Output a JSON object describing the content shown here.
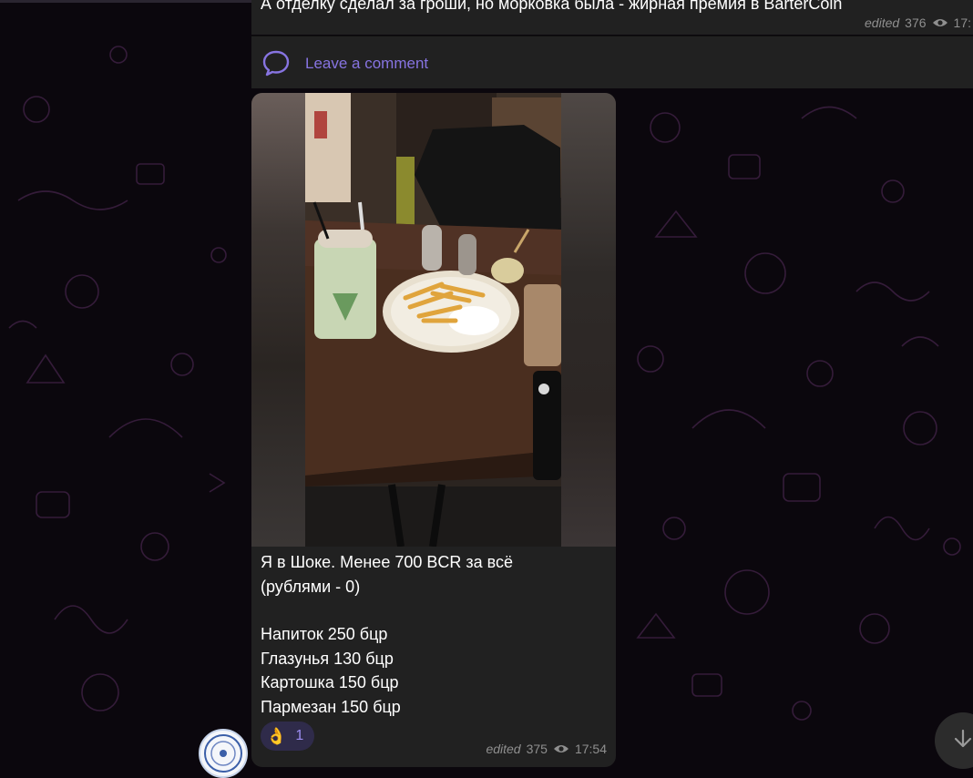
{
  "previous_message": {
    "text": "А отделку сделал за гроши, но морковка была - жирная премия в BarterCoin",
    "edited_label": "edited",
    "views": "376",
    "time": "17:"
  },
  "comments": {
    "label": "Leave a comment",
    "icon": "comment-bubble-icon"
  },
  "post": {
    "caption_lines": [
      "Я в Шоке. Менее 700 BCR за всё",
      "(рублями - 0)",
      "",
      "Напиток 250 бцр",
      "Глазунья 130 бцр",
      "Картошка 150 бцр",
      "Пармезан 150 бцр"
    ],
    "reaction": {
      "emoji": "👌",
      "count": "1"
    },
    "edited_label": "edited",
    "views": "375",
    "time": "17:54"
  },
  "colors": {
    "bubble": "#212121",
    "accent": "#8774e1",
    "background": "#0b070d",
    "meta": "#8f8f8f"
  },
  "icons": [
    "eye-icon",
    "comment-bubble-icon",
    "arrow-down-icon",
    "channel-avatar"
  ]
}
